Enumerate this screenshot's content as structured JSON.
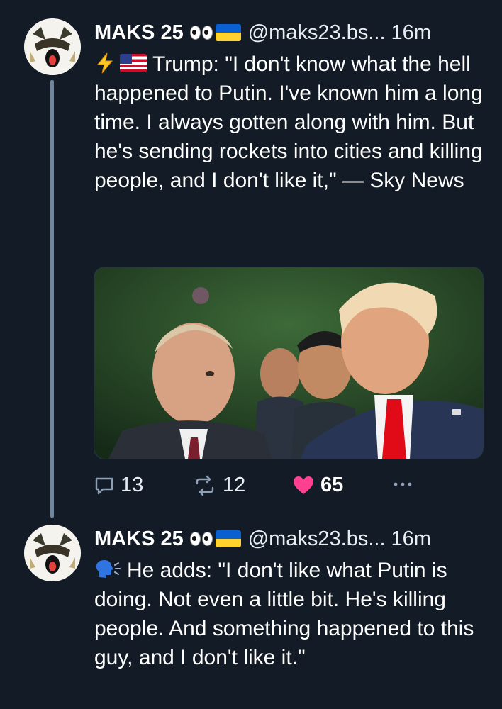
{
  "posts": [
    {
      "author_name": "MAKS 25",
      "handle": "@maks23.bs...",
      "time": "16m",
      "text": "Trump: \"I don't know what the hell happened to Putin. I've known him a long time. I always gotten along with him. But he's sending rockets into cities and killing people, and I don't like it,\" — Sky News",
      "lead_icons": [
        "lightning-icon",
        "us-flag-icon"
      ],
      "media_description_icon": "photo-icon",
      "stats": {
        "replies": "13",
        "reposts": "12",
        "likes": "65"
      }
    },
    {
      "author_name": "MAKS 25",
      "handle": "@maks23.bs...",
      "time": "16m",
      "text": "He adds: \"I don't like what Putin is doing. Not even a little bit. He's killing people. And something happened to this guy, and I don't like it.\"",
      "lead_icons": [
        "speaking-head-icon"
      ]
    }
  ],
  "colors": {
    "background": "#131c26",
    "text": "#ffffff",
    "thread_line": "#6f86a3",
    "like": "#ff3f8f",
    "ua_blue": "#0a5fd1",
    "ua_yellow": "#ffd22e"
  }
}
